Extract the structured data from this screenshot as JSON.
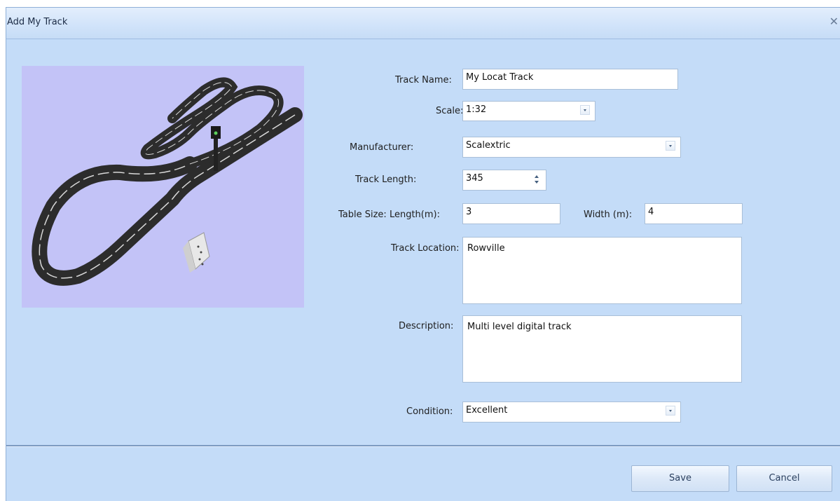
{
  "window": {
    "title": "Add My Track"
  },
  "form": {
    "track_name": {
      "label": "Track Name:",
      "value": "My Locat Track"
    },
    "scale": {
      "label": "Scale:",
      "value": "1:32"
    },
    "manufacturer": {
      "label": "Manufacturer:",
      "value": "Scalextric"
    },
    "track_length": {
      "label": "Track Length:",
      "value": "345"
    },
    "table_size": {
      "length_label": "Table Size: Length(m):",
      "length_value": "3",
      "width_label": "Width (m):",
      "width_value": "4"
    },
    "track_location": {
      "label": "Track Location:",
      "value": "Rowville"
    },
    "description": {
      "label": "Description:",
      "value": "Multi level digital track"
    },
    "condition": {
      "label": "Condition:",
      "value": "Excellent"
    }
  },
  "buttons": {
    "save": "Save",
    "cancel": "Cancel"
  },
  "colors": {
    "window_bg": "#c4dcf8",
    "preview_bg": "#c3c3f7",
    "track": "#333333"
  },
  "icons": [
    "close-icon",
    "chevron-down-icon",
    "spinner-icon"
  ]
}
